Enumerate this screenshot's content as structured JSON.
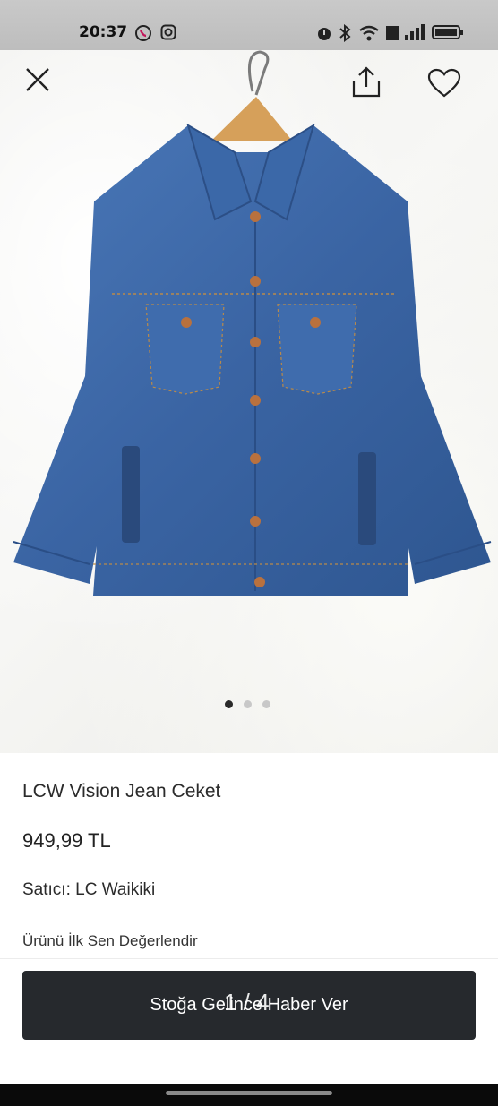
{
  "status_bar": {
    "time": "20:37",
    "icons": [
      "viber-icon",
      "instagram-icon",
      "alarm-icon",
      "bluetooth-icon",
      "wifi-icon",
      "volte-icon",
      "signal-icon",
      "battery-icon"
    ]
  },
  "gallery": {
    "image_alt": "denim-jacket-product-image",
    "dots_total": 3,
    "active_dot": 1,
    "counter": "1 / 4"
  },
  "top_actions": [
    "close-icon",
    "share-icon",
    "heart-icon"
  ],
  "product": {
    "name": "LCW Vision Jean Ceket",
    "price": "949,99 TL",
    "seller_label": "Satıcı:",
    "seller_name": "LC Waikiki",
    "review_link": "Ürünü İlk Sen Değerlendir"
  },
  "cta": {
    "label": "Stoğa Gelince Haber Ver"
  },
  "colors": {
    "cta_bg": "#26292d",
    "denim": "#3a64a3",
    "background": "#ffffff"
  }
}
